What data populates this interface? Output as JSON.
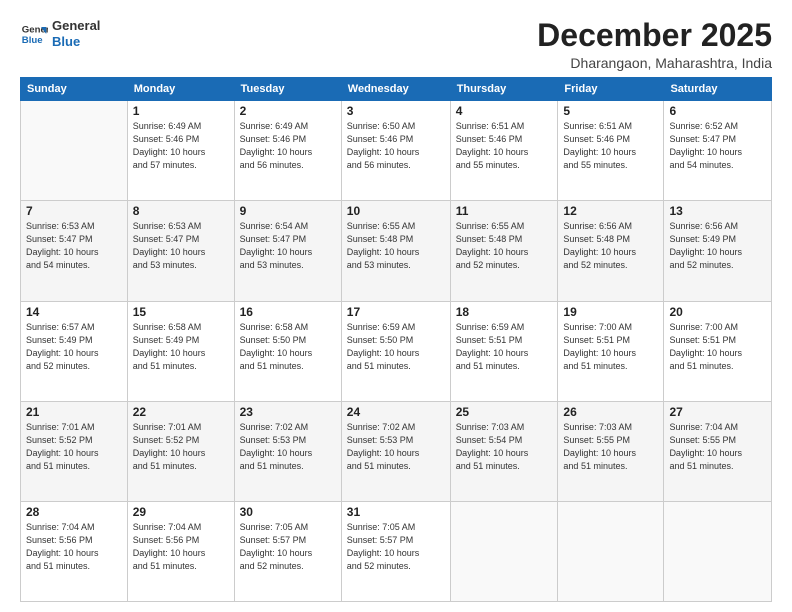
{
  "logo": {
    "line1": "General",
    "line2": "Blue"
  },
  "title": "December 2025",
  "subtitle": "Dharangaon, Maharashtra, India",
  "days_of_week": [
    "Sunday",
    "Monday",
    "Tuesday",
    "Wednesday",
    "Thursday",
    "Friday",
    "Saturday"
  ],
  "weeks": [
    [
      {
        "num": "",
        "info": ""
      },
      {
        "num": "1",
        "info": "Sunrise: 6:49 AM\nSunset: 5:46 PM\nDaylight: 10 hours\nand 57 minutes."
      },
      {
        "num": "2",
        "info": "Sunrise: 6:49 AM\nSunset: 5:46 PM\nDaylight: 10 hours\nand 56 minutes."
      },
      {
        "num": "3",
        "info": "Sunrise: 6:50 AM\nSunset: 5:46 PM\nDaylight: 10 hours\nand 56 minutes."
      },
      {
        "num": "4",
        "info": "Sunrise: 6:51 AM\nSunset: 5:46 PM\nDaylight: 10 hours\nand 55 minutes."
      },
      {
        "num": "5",
        "info": "Sunrise: 6:51 AM\nSunset: 5:46 PM\nDaylight: 10 hours\nand 55 minutes."
      },
      {
        "num": "6",
        "info": "Sunrise: 6:52 AM\nSunset: 5:47 PM\nDaylight: 10 hours\nand 54 minutes."
      }
    ],
    [
      {
        "num": "7",
        "info": "Sunrise: 6:53 AM\nSunset: 5:47 PM\nDaylight: 10 hours\nand 54 minutes."
      },
      {
        "num": "8",
        "info": "Sunrise: 6:53 AM\nSunset: 5:47 PM\nDaylight: 10 hours\nand 53 minutes."
      },
      {
        "num": "9",
        "info": "Sunrise: 6:54 AM\nSunset: 5:47 PM\nDaylight: 10 hours\nand 53 minutes."
      },
      {
        "num": "10",
        "info": "Sunrise: 6:55 AM\nSunset: 5:48 PM\nDaylight: 10 hours\nand 53 minutes."
      },
      {
        "num": "11",
        "info": "Sunrise: 6:55 AM\nSunset: 5:48 PM\nDaylight: 10 hours\nand 52 minutes."
      },
      {
        "num": "12",
        "info": "Sunrise: 6:56 AM\nSunset: 5:48 PM\nDaylight: 10 hours\nand 52 minutes."
      },
      {
        "num": "13",
        "info": "Sunrise: 6:56 AM\nSunset: 5:49 PM\nDaylight: 10 hours\nand 52 minutes."
      }
    ],
    [
      {
        "num": "14",
        "info": "Sunrise: 6:57 AM\nSunset: 5:49 PM\nDaylight: 10 hours\nand 52 minutes."
      },
      {
        "num": "15",
        "info": "Sunrise: 6:58 AM\nSunset: 5:49 PM\nDaylight: 10 hours\nand 51 minutes."
      },
      {
        "num": "16",
        "info": "Sunrise: 6:58 AM\nSunset: 5:50 PM\nDaylight: 10 hours\nand 51 minutes."
      },
      {
        "num": "17",
        "info": "Sunrise: 6:59 AM\nSunset: 5:50 PM\nDaylight: 10 hours\nand 51 minutes."
      },
      {
        "num": "18",
        "info": "Sunrise: 6:59 AM\nSunset: 5:51 PM\nDaylight: 10 hours\nand 51 minutes."
      },
      {
        "num": "19",
        "info": "Sunrise: 7:00 AM\nSunset: 5:51 PM\nDaylight: 10 hours\nand 51 minutes."
      },
      {
        "num": "20",
        "info": "Sunrise: 7:00 AM\nSunset: 5:51 PM\nDaylight: 10 hours\nand 51 minutes."
      }
    ],
    [
      {
        "num": "21",
        "info": "Sunrise: 7:01 AM\nSunset: 5:52 PM\nDaylight: 10 hours\nand 51 minutes."
      },
      {
        "num": "22",
        "info": "Sunrise: 7:01 AM\nSunset: 5:52 PM\nDaylight: 10 hours\nand 51 minutes."
      },
      {
        "num": "23",
        "info": "Sunrise: 7:02 AM\nSunset: 5:53 PM\nDaylight: 10 hours\nand 51 minutes."
      },
      {
        "num": "24",
        "info": "Sunrise: 7:02 AM\nSunset: 5:53 PM\nDaylight: 10 hours\nand 51 minutes."
      },
      {
        "num": "25",
        "info": "Sunrise: 7:03 AM\nSunset: 5:54 PM\nDaylight: 10 hours\nand 51 minutes."
      },
      {
        "num": "26",
        "info": "Sunrise: 7:03 AM\nSunset: 5:55 PM\nDaylight: 10 hours\nand 51 minutes."
      },
      {
        "num": "27",
        "info": "Sunrise: 7:04 AM\nSunset: 5:55 PM\nDaylight: 10 hours\nand 51 minutes."
      }
    ],
    [
      {
        "num": "28",
        "info": "Sunrise: 7:04 AM\nSunset: 5:56 PM\nDaylight: 10 hours\nand 51 minutes."
      },
      {
        "num": "29",
        "info": "Sunrise: 7:04 AM\nSunset: 5:56 PM\nDaylight: 10 hours\nand 51 minutes."
      },
      {
        "num": "30",
        "info": "Sunrise: 7:05 AM\nSunset: 5:57 PM\nDaylight: 10 hours\nand 52 minutes."
      },
      {
        "num": "31",
        "info": "Sunrise: 7:05 AM\nSunset: 5:57 PM\nDaylight: 10 hours\nand 52 minutes."
      },
      {
        "num": "",
        "info": ""
      },
      {
        "num": "",
        "info": ""
      },
      {
        "num": "",
        "info": ""
      }
    ]
  ]
}
